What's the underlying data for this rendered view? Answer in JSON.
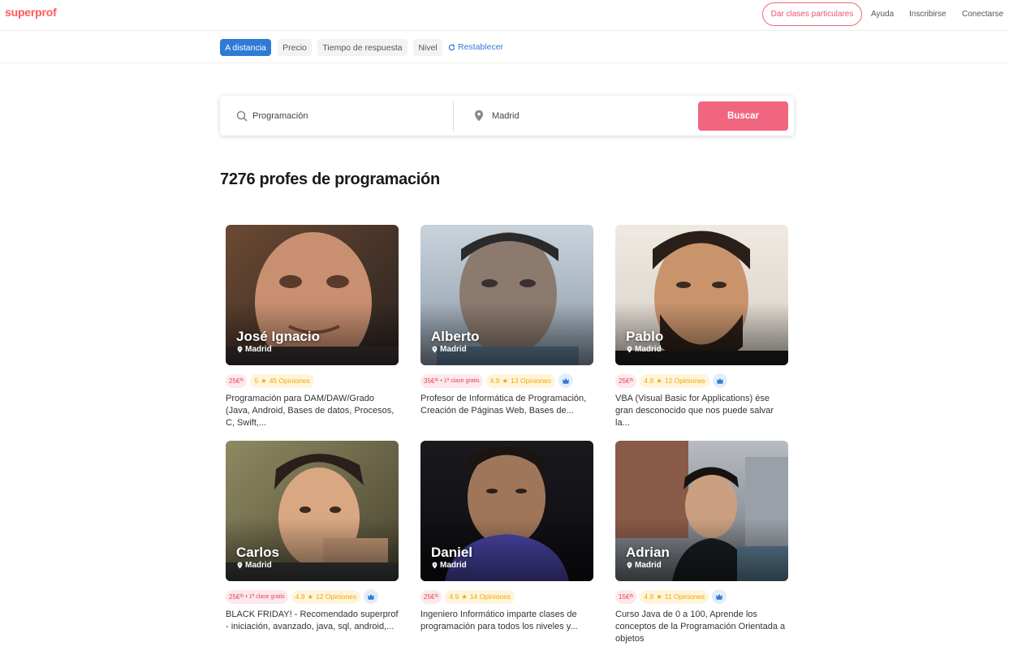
{
  "header": {
    "logo": "superprof",
    "give_classes": "Dar clases particulares",
    "links": [
      "Ayuda",
      "Inscribirse",
      "Conectarse"
    ]
  },
  "filters": {
    "chips": [
      "A distancia",
      "Precio",
      "Tiempo de respuesta",
      "Nivel"
    ],
    "active": "A distancia",
    "reset": "Restablecer"
  },
  "search": {
    "subject": "Programación",
    "location": "Madrid",
    "button": "Buscar"
  },
  "results_title": "7276 profes de programación",
  "colors": {
    "brand": "#ff5a5f",
    "accent_blue": "#2e7bd6",
    "search_button": "#f0667f",
    "star": "#f2a900"
  },
  "tutors": [
    {
      "name": "José Ignacio",
      "location": "Madrid",
      "price": "25€",
      "per": "/h",
      "free_class": "",
      "rating": "5",
      "reviews": "45 Opiniones",
      "badge": false,
      "description": "Programación para DAM/DAW/Grado (Java, Android, Bases de datos, Procesos, C, Swift,..."
    },
    {
      "name": "Alberto",
      "location": "Madrid",
      "price": "35€",
      "per": "/h",
      "free_class": "• 1ª clase gratis",
      "rating": "4.9",
      "reviews": "13 Opiniones",
      "badge": true,
      "description": "Profesor de Informática de Programación, Creación de Páginas Web, Bases de..."
    },
    {
      "name": "Pablo",
      "location": "Madrid",
      "price": "25€",
      "per": "/h",
      "free_class": "",
      "rating": "4.9",
      "reviews": "12 Opiniones",
      "badge": true,
      "description": "VBA (Visual Basic for Applications) ése gran desconocido que nos puede salvar la..."
    },
    {
      "name": "Carlos",
      "location": "Madrid",
      "price": "25€",
      "per": "/h",
      "free_class": "• 1ª clase gratis",
      "rating": "4.9",
      "reviews": "12 Opiniones",
      "badge": true,
      "description": "BLACK FRIDAY! - Recomendado superprof - iniciación, avanzado, java, sql, android,..."
    },
    {
      "name": "Daniel",
      "location": "Madrid",
      "price": "25€",
      "per": "/h",
      "free_class": "",
      "rating": "4.9",
      "reviews": "14 Opiniones",
      "badge": false,
      "description": "Ingeniero Informático imparte clases de programación para todos los niveles y..."
    },
    {
      "name": "Adrian",
      "location": "Madrid",
      "price": "15€",
      "per": "/h",
      "free_class": "",
      "rating": "4.9",
      "reviews": "11 Opiniones",
      "badge": true,
      "description": "Curso Java de 0 a 100, Aprende los conceptos de la Programación Orientada a objetos"
    }
  ]
}
